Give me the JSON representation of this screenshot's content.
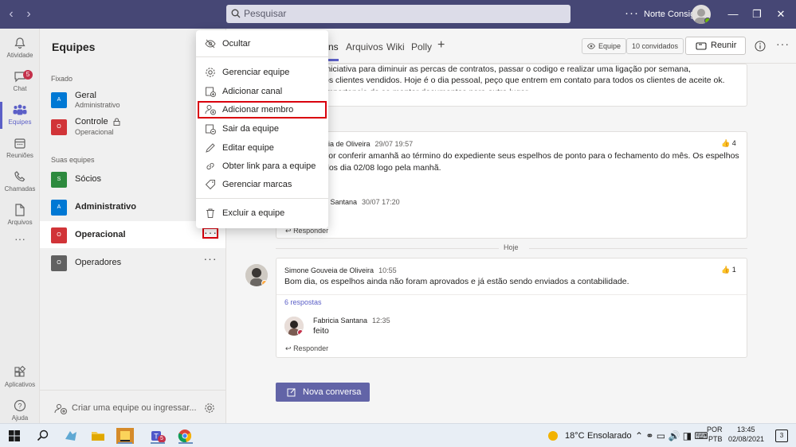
{
  "titlebar": {
    "search_placeholder": "Pesquisar",
    "more": "···",
    "user_name": "Norte Consig",
    "minimize": "—",
    "maximize": "❐",
    "close": "✕"
  },
  "rail": [
    {
      "label": "Atividade",
      "icon": "bell-icon"
    },
    {
      "label": "Chat",
      "icon": "chat-icon",
      "badge": "5"
    },
    {
      "label": "Equipes",
      "icon": "teams-icon",
      "active": true
    },
    {
      "label": "Reuniões",
      "icon": "calendar-icon"
    },
    {
      "label": "Chamadas",
      "icon": "phone-icon"
    },
    {
      "label": "Arquivos",
      "icon": "file-icon"
    },
    {
      "label": "···",
      "icon": "more-icon"
    },
    {
      "label": "Aplicativos",
      "icon": "apps-icon"
    },
    {
      "label": "Ajuda",
      "icon": "help-icon"
    }
  ],
  "teams_panel": {
    "title": "Equipes",
    "section_pinned": "Fixado",
    "section_yours": "Suas equipes",
    "pinned": [
      {
        "initial": "A",
        "name": "Geral",
        "sub": "Administrativo",
        "color": "#0078d4"
      },
      {
        "initial": "O",
        "name": "Controle",
        "sub": "Operacional",
        "color": "#d13438"
      }
    ],
    "teams": [
      {
        "initial": "S",
        "name": "Sócios",
        "color": "#2d8a3e"
      },
      {
        "initial": "A",
        "name": "Administrativo",
        "color": "#0078d4",
        "bold": true
      },
      {
        "initial": "O",
        "name": "Operacional",
        "color": "#d13438",
        "bold": true
      },
      {
        "initial": "O",
        "name": "Operadores",
        "color": "#616161"
      }
    ],
    "team_more": "···",
    "create": "Criar uma equipe ou ingressar..."
  },
  "context_menu": {
    "items": [
      {
        "label": "Ocultar",
        "icon": "eye-off-icon"
      },
      {
        "label": "Gerenciar equipe",
        "icon": "gear-icon"
      },
      {
        "label": "Adicionar canal",
        "icon": "add-channel-icon"
      },
      {
        "label": "Adicionar membro",
        "icon": "add-person-icon"
      },
      {
        "label": "Sair da equipe",
        "icon": "leave-icon"
      },
      {
        "label": "Editar equipe",
        "icon": "pencil-icon"
      },
      {
        "label": "Obter link para a equipe",
        "icon": "link-icon"
      },
      {
        "label": "Gerenciar marcas",
        "icon": "tag-icon"
      },
      {
        "label": "Excluir a equipe",
        "icon": "trash-icon"
      }
    ]
  },
  "channel": {
    "tabs": [
      "ns",
      "Arquivos",
      "Wiki",
      "Polly"
    ],
    "add_tab": "+",
    "equipe_pill": "Equipe",
    "convidados_pill": "10 convidados",
    "reunir": "Reunir",
    "msg1": {
      "line1": "iniciativa para diminuir as percas de contratos, passar o codigo e realizar uma ligação por semana,",
      "line2": "os clientes vendidos. Hoje é o dia pessoal, peço que entrem em contato para todos os  clientes de aceite ok.",
      "line3": "importancia de se manter documentos para outro lugar"
    },
    "msg2": {
      "author": "eia de Oliveira",
      "time": "29/07 19:57",
      "line1": "vor conferir amanhã ao término do expediente seus espelhos de ponto para o fechamento do mês. Os espelhos",
      "line2": "dos dia 02/08 logo pela manhã.",
      "reaction": "4",
      "reply_author": "a Santana",
      "reply_time": "30/07 17:20",
      "reply_label": "Responder"
    },
    "today": "Hoje",
    "msg3": {
      "author": "Simone Gouveia de Oliveira",
      "time": "10:55",
      "text": "Bom dia, os espelhos ainda não foram aprovados e já estão sendo enviados a contabilidade.",
      "reaction": "1",
      "replies_link": "6 respostas",
      "reply_author": "Fabricia Santana",
      "reply_time": "12:35",
      "reply_text": "feito",
      "reply_label": "Responder"
    },
    "new_conversation": "Nova conversa"
  },
  "taskbar": {
    "teams_badge": "5",
    "temp": "18°C",
    "weather": "Ensolarado",
    "lang1": "POR",
    "lang2": "PTB",
    "time": "13:45",
    "date": "02/08/2021",
    "notif_count": "3"
  }
}
